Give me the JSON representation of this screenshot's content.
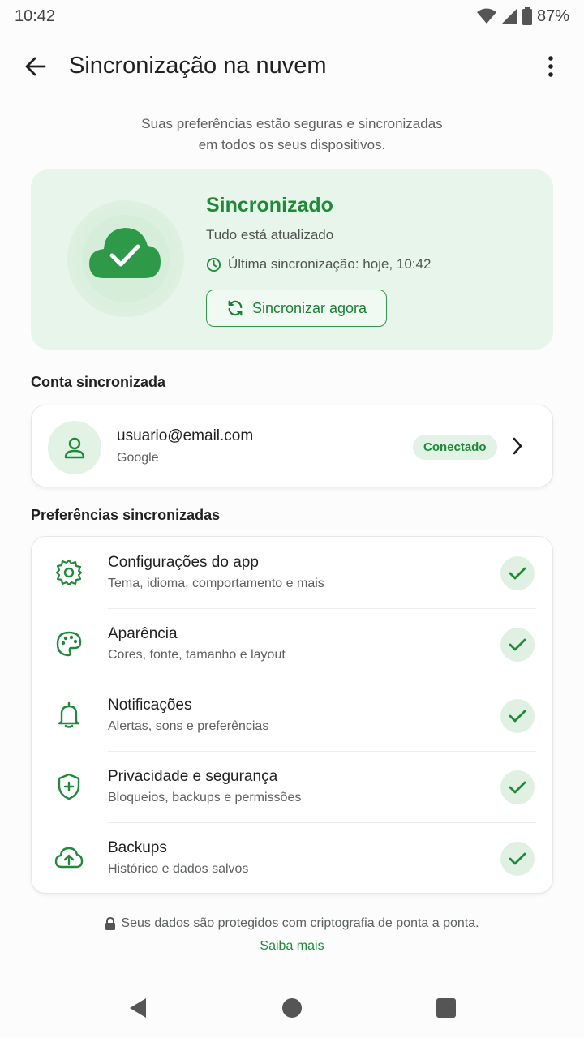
{
  "status_bar": {
    "time": "10:42",
    "battery": "87%"
  },
  "app_bar": {
    "title": "Sincronização na nuvem"
  },
  "intro": {
    "line1": "Suas preferências estão seguras e sincronizadas",
    "line2": "em todos os seus dispositivos."
  },
  "sync": {
    "title": "Sincronizado",
    "status": "Tudo está atualizado",
    "last_sync": "Última sincronização: hoje, 10:42",
    "button_label": "Sincronizar agora"
  },
  "account": {
    "section_label": "Conta sincronizada",
    "email": "usuario@email.com",
    "provider": "Google",
    "badge": "Conectado"
  },
  "preferences": {
    "section_label": "Preferências sincronizadas",
    "items": [
      {
        "title": "Configurações do app",
        "desc": "Tema, idioma, comportamento e mais",
        "icon": "gear-icon"
      },
      {
        "title": "Aparência",
        "desc": "Cores, fonte, tamanho e layout",
        "icon": "palette-icon"
      },
      {
        "title": "Notificações",
        "desc": "Alertas, sons e preferências",
        "icon": "bell-icon"
      },
      {
        "title": "Privacidade e segurança",
        "desc": "Bloqueios, backups e permissões",
        "icon": "shield-icon"
      },
      {
        "title": "Backups",
        "desc": "Histórico e dados salvos",
        "icon": "cloud-upload-icon"
      }
    ]
  },
  "footer": {
    "note": "Seus dados são protegidos com criptografia de ponta a ponta.",
    "link": "Saiba mais"
  },
  "colors": {
    "accent": "#1e8a3a",
    "card_bg": "#e8f5ea"
  }
}
